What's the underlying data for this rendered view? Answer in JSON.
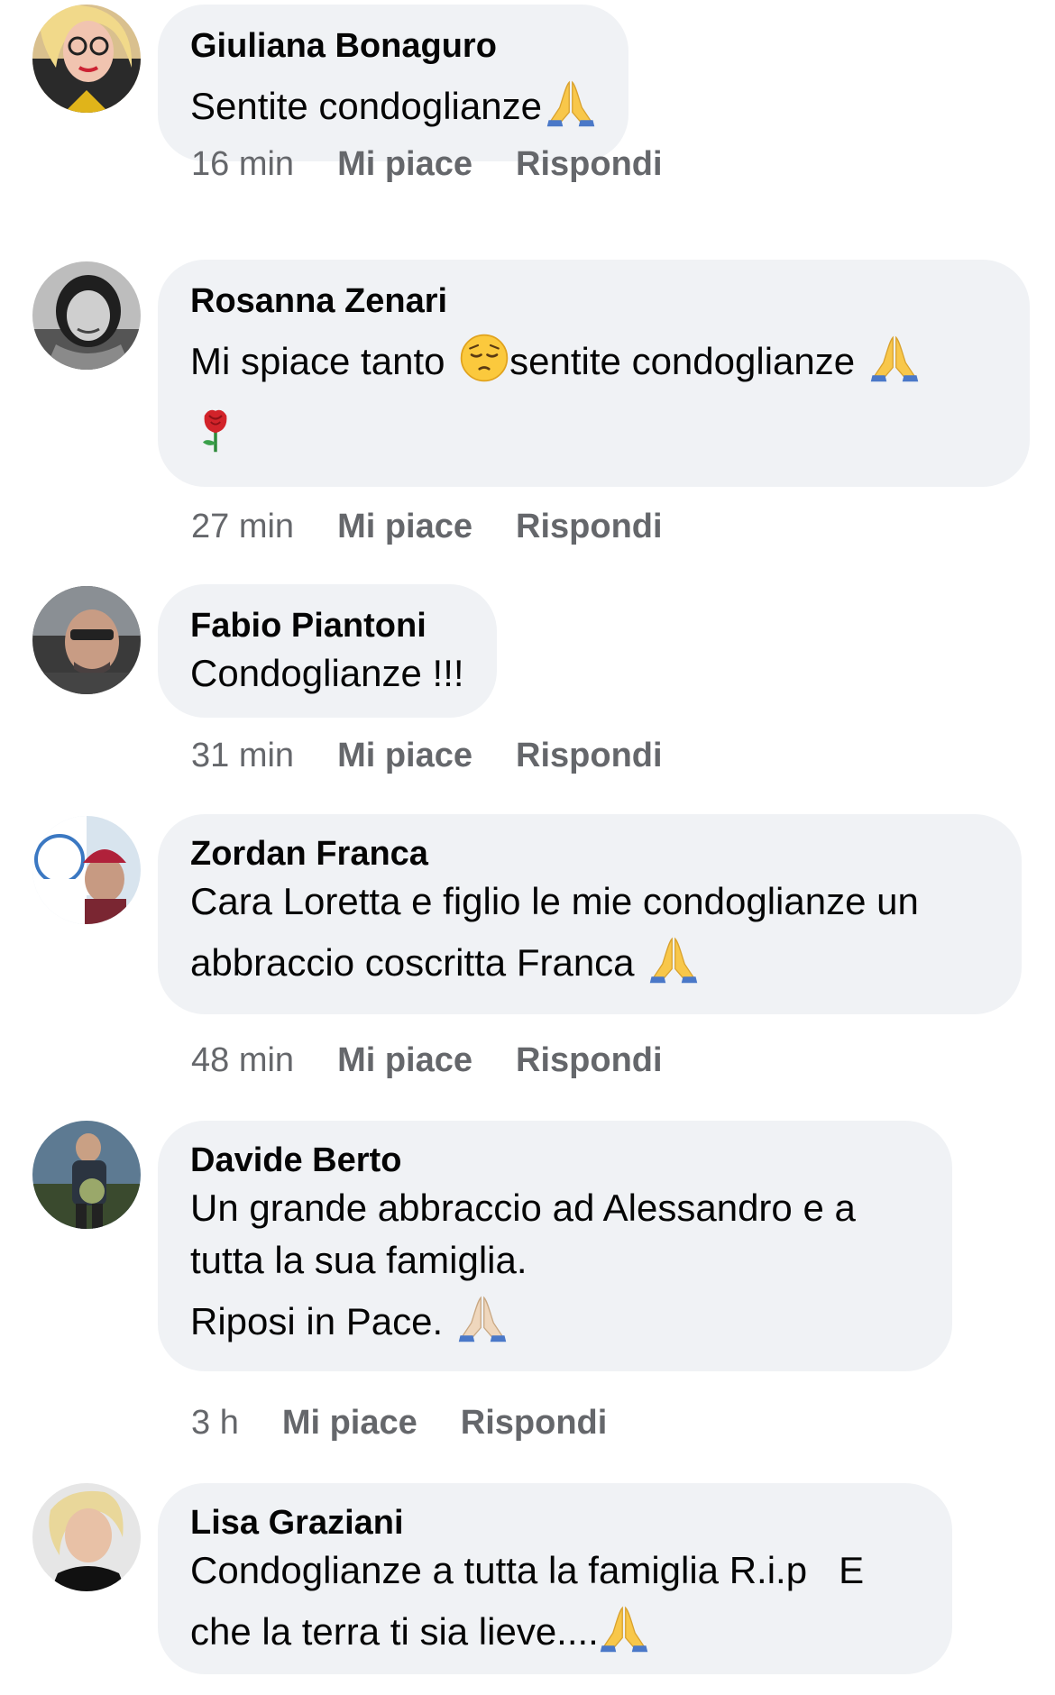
{
  "actions": {
    "like_label": "Mi piace",
    "reply_label": "Rispondi"
  },
  "icons": {
    "pray": "folded-hands-emoji",
    "pensive": "pensive-face-emoji",
    "rose": "rose-emoji"
  },
  "comments": [
    {
      "author": "Giuliana Bonaguro",
      "lines": [
        "Sentite condoglianze"
      ],
      "time": "16 min"
    },
    {
      "author": "Rosanna Zenari",
      "line1_a": "Mi spiace tanto",
      "line1_b": "sentite condoglianze",
      "time": "27 min"
    },
    {
      "author": "Fabio Piantoni",
      "lines": [
        "Condoglianze !!!"
      ],
      "time": "31 min"
    },
    {
      "author": "Zordan Franca",
      "lines": [
        "Cara Loretta e figlio le mie condoglianze un",
        "abbraccio coscritta Franca"
      ],
      "time": "48 min"
    },
    {
      "author": "Davide Berto",
      "lines": [
        "Un grande abbraccio ad Alessandro e a",
        "tutta la sua famiglia.",
        "Riposi in Pace."
      ],
      "time": "3 h"
    },
    {
      "author": "Lisa Graziani",
      "lines": [
        "Condoglianze a tutta la famiglia R.i.p   E",
        "che la terra ti sia lieve...."
      ]
    }
  ]
}
